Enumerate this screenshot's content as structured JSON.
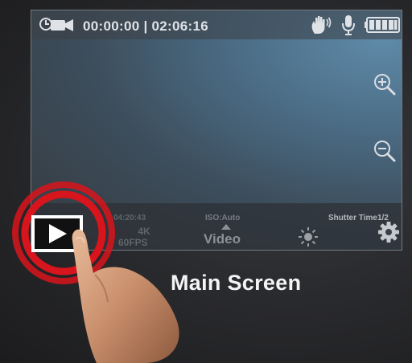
{
  "header": {
    "timecode": "00:00:00 | 02:06:16",
    "camera_icon": "video-camera-timer-icon",
    "gesture_icon": "hand-wave-icon",
    "mic_icon": "microphone-icon",
    "battery_icon": "battery-full-icon",
    "battery_level": 1.0
  },
  "side_controls": {
    "zoom_in_icon": "zoom-in-icon",
    "zoom_out_icon": "zoom-out-icon"
  },
  "bottom_bar": {
    "remaining_time": "04:20:43",
    "resolution": "4K",
    "fps": "60FPS",
    "iso": "ISO:Auto",
    "mode": "Video",
    "brightness_icon": "brightness-icon",
    "shutter": "Shutter Time1/2",
    "settings_icon": "gear-icon"
  },
  "playback": {
    "play_icon": "play-icon"
  },
  "caption": {
    "text": "Main Screen"
  },
  "colors": {
    "accent_red": "#d8141c",
    "screen_blue": "#5f8aa8",
    "label_white": "#f4f4f4"
  }
}
